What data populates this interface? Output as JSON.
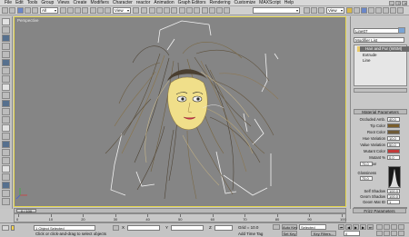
{
  "menu": {
    "items": [
      "File",
      "Edit",
      "Tools",
      "Group",
      "Views",
      "Create",
      "Modifiers",
      "Character",
      "reactor",
      "Animation",
      "Graph Editors",
      "Rendering",
      "Customize",
      "MAXScript",
      "Help"
    ]
  },
  "toolbar": {
    "selection_filter": "All",
    "coord_system": "View"
  },
  "viewport": {
    "label": "Perspective"
  },
  "command_panel": {
    "object_name": "Line07",
    "modifier_list": "Modifier List",
    "stack": [
      "Hair and Fur (WSM)",
      "Extrude",
      "Line"
    ],
    "stack_colors": [
      "#e8c96a",
      "#6b6b6b",
      "#6b6b6b"
    ],
    "rollouts": {
      "material": "Material Parameters",
      "frizz": "Frizz Parameters"
    },
    "material_params": [
      {
        "label": "Occluded Amb.",
        "value": "40.0"
      },
      {
        "label": "Tip Color",
        "swatch": "#7a5e2c"
      },
      {
        "label": "Root Color",
        "swatch": "#6e5a36"
      },
      {
        "label": "Hue Variation",
        "value": "10.0"
      },
      {
        "label": "Value Variation",
        "value": "50.0"
      },
      {
        "label": "Mutant Color",
        "swatch": "#c23a3a"
      },
      {
        "label": "Mutant %",
        "value": "0.0"
      },
      {
        "label": "Specular",
        "value": "75.0"
      },
      {
        "label": "Glossiness",
        "value": "75.0"
      },
      {
        "label": "Self Shadow",
        "value": "100.0"
      },
      {
        "label": "Geom Shadow",
        "value": "100.0"
      },
      {
        "label": "Geom Mat ID",
        "value": "1"
      }
    ]
  },
  "timeline": {
    "frame_counter": "0 / 100",
    "ticks": [
      "0",
      "10",
      "20",
      "30",
      "40",
      "50",
      "60",
      "70",
      "80",
      "90",
      "100"
    ]
  },
  "status": {
    "selection": "1 Object Selected",
    "prompt": "Click or click-and-drag to select objects",
    "grid": "Grid = 10.0",
    "x_label": "X",
    "y_label": "Y",
    "z_label": "Z",
    "auto_key": "Auto Key",
    "selected": "Selected",
    "set_key": "Set Key",
    "key_filters": "Key Filters...",
    "add_time_tag": "Add Time Tag",
    "frame": "0"
  }
}
